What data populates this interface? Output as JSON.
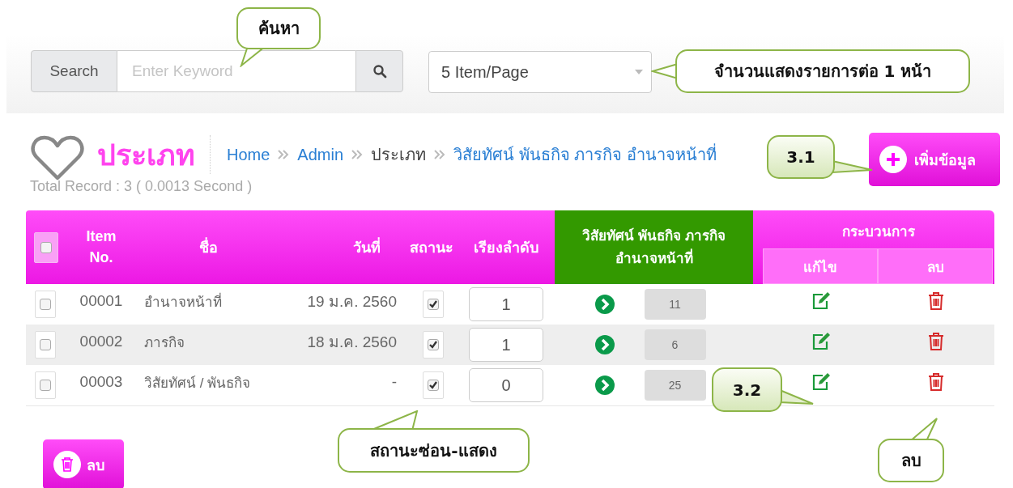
{
  "search": {
    "label": "Search",
    "placeholder": "Enter Keyword"
  },
  "page_size": {
    "value": "5 Item/Page"
  },
  "page_title": "ประเภท",
  "breadcrumb": [
    {
      "label": "Home",
      "kind": "link"
    },
    {
      "label": "Admin",
      "kind": "link"
    },
    {
      "label": "ประเภท",
      "kind": "text"
    },
    {
      "label": "วิสัยทัศน์ พันธกิจ ภารกิจ อำนาจหน้าที่",
      "kind": "link"
    }
  ],
  "add_button": "เพิ่มข้อมูล",
  "total_record": "Total Record : 3 ( 0.0013 Second )",
  "table": {
    "select_all_checked": false,
    "columns": [
      "Item No.",
      "ชื่อ",
      "วันที่",
      "สถานะ",
      "เรียงลำดับ",
      "วิสัยทัศน์ พันธกิจ ภารกิจ อำนาจหน้าที่",
      "กระบวนการ"
    ],
    "subcolumns": [
      "แก้ไข",
      "ลบ"
    ],
    "rows": [
      {
        "selected": false,
        "item_no": "00001",
        "name": "อำนาจหน้าที่",
        "date": "19 ม.ค. 2560",
        "status_checked": true,
        "order": "1",
        "count": "11"
      },
      {
        "selected": false,
        "item_no": "00002",
        "name": "ภารกิจ",
        "date": "18 ม.ค. 2560",
        "status_checked": true,
        "order": "1",
        "count": "6"
      },
      {
        "selected": false,
        "item_no": "00003",
        "name": "วิสัยทัศน์ / พันธกิจ",
        "date": "-",
        "status_checked": true,
        "order": "0",
        "count": "25"
      }
    ]
  },
  "delete_button": "ลบ",
  "callouts": [
    {
      "text": "ค้นหา"
    },
    {
      "text": "จำนวนแสดงรายการต่อ 1 หน้า"
    },
    {
      "text": "3.1"
    },
    {
      "text": "3.2"
    },
    {
      "text": "สถานะซ่อน-แสดง"
    },
    {
      "text": "ลบ"
    }
  ]
}
